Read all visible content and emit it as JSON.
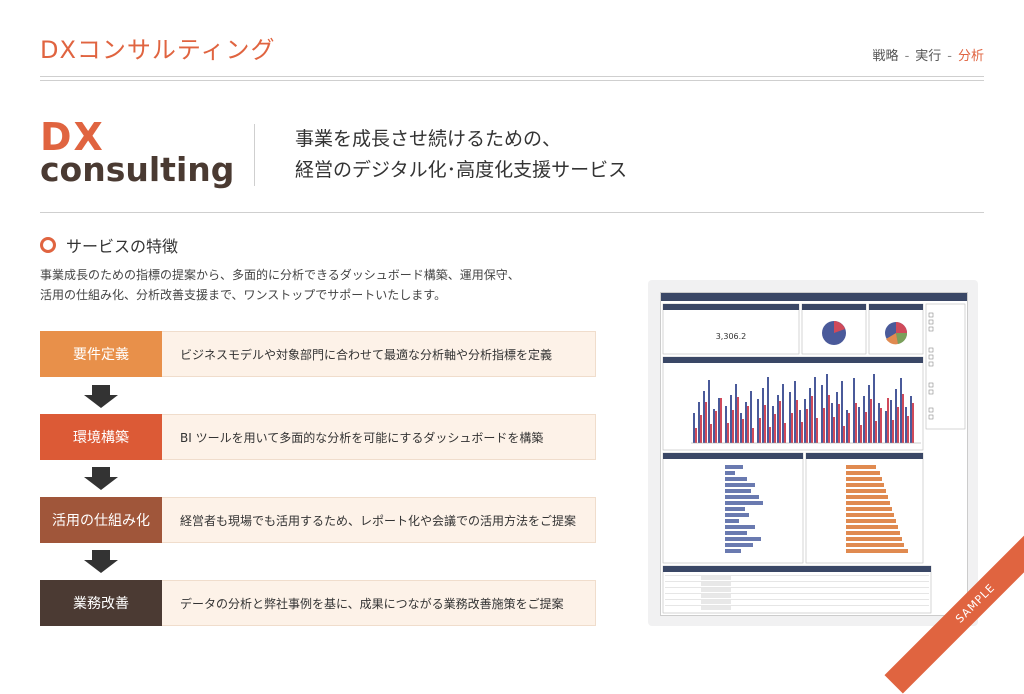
{
  "header": {
    "brand": "DXコンサルティング",
    "nav": [
      "戦略",
      "実行",
      "分析"
    ],
    "nav_active_index": 2
  },
  "hero": {
    "logo_line1": "DX",
    "logo_line2": "consulting",
    "tagline_line1": "事業を成長させ続けるための、",
    "tagline_line2": "経営のデジタル化･高度化支援サービス"
  },
  "features": {
    "title": "サービスの特徴",
    "description_line1": "事業成長のための指標の提案から、多面的に分析できるダッシュボード構築、運用保守、",
    "description_line2": "活用の仕組み化、分析改善支援まで、ワンストップでサポートいたします。",
    "steps": [
      {
        "label": "要件定義",
        "text": "ビジネスモデルや対象部門に合わせて最適な分析軸や分析指標を定義",
        "color": "#e8904a"
      },
      {
        "label": "環境構築",
        "text": "BI ツールを用いて多面的な分析を可能にするダッシュボードを構築",
        "color": "#dc5a36"
      },
      {
        "label": "活用の仕組み化",
        "text": "経営者も現場でも活用するため、レポート化や会議での活用方法をご提案",
        "color": "#a0563a"
      },
      {
        "label": "業務改善",
        "text": "データの分析と弊社事例を基に、成果につながる業務改善施策をご提案",
        "color": "#4b3a33"
      }
    ]
  },
  "dashboard_preview": {
    "kpi_value": "3,306.2",
    "badge": "SAMPLE"
  },
  "colors": {
    "accent": "#e06440",
    "dark_brown": "#4a3a32",
    "bar_blue": "#4a5a9a",
    "bar_red": "#d04a5a",
    "bar_orange": "#e08a50"
  }
}
